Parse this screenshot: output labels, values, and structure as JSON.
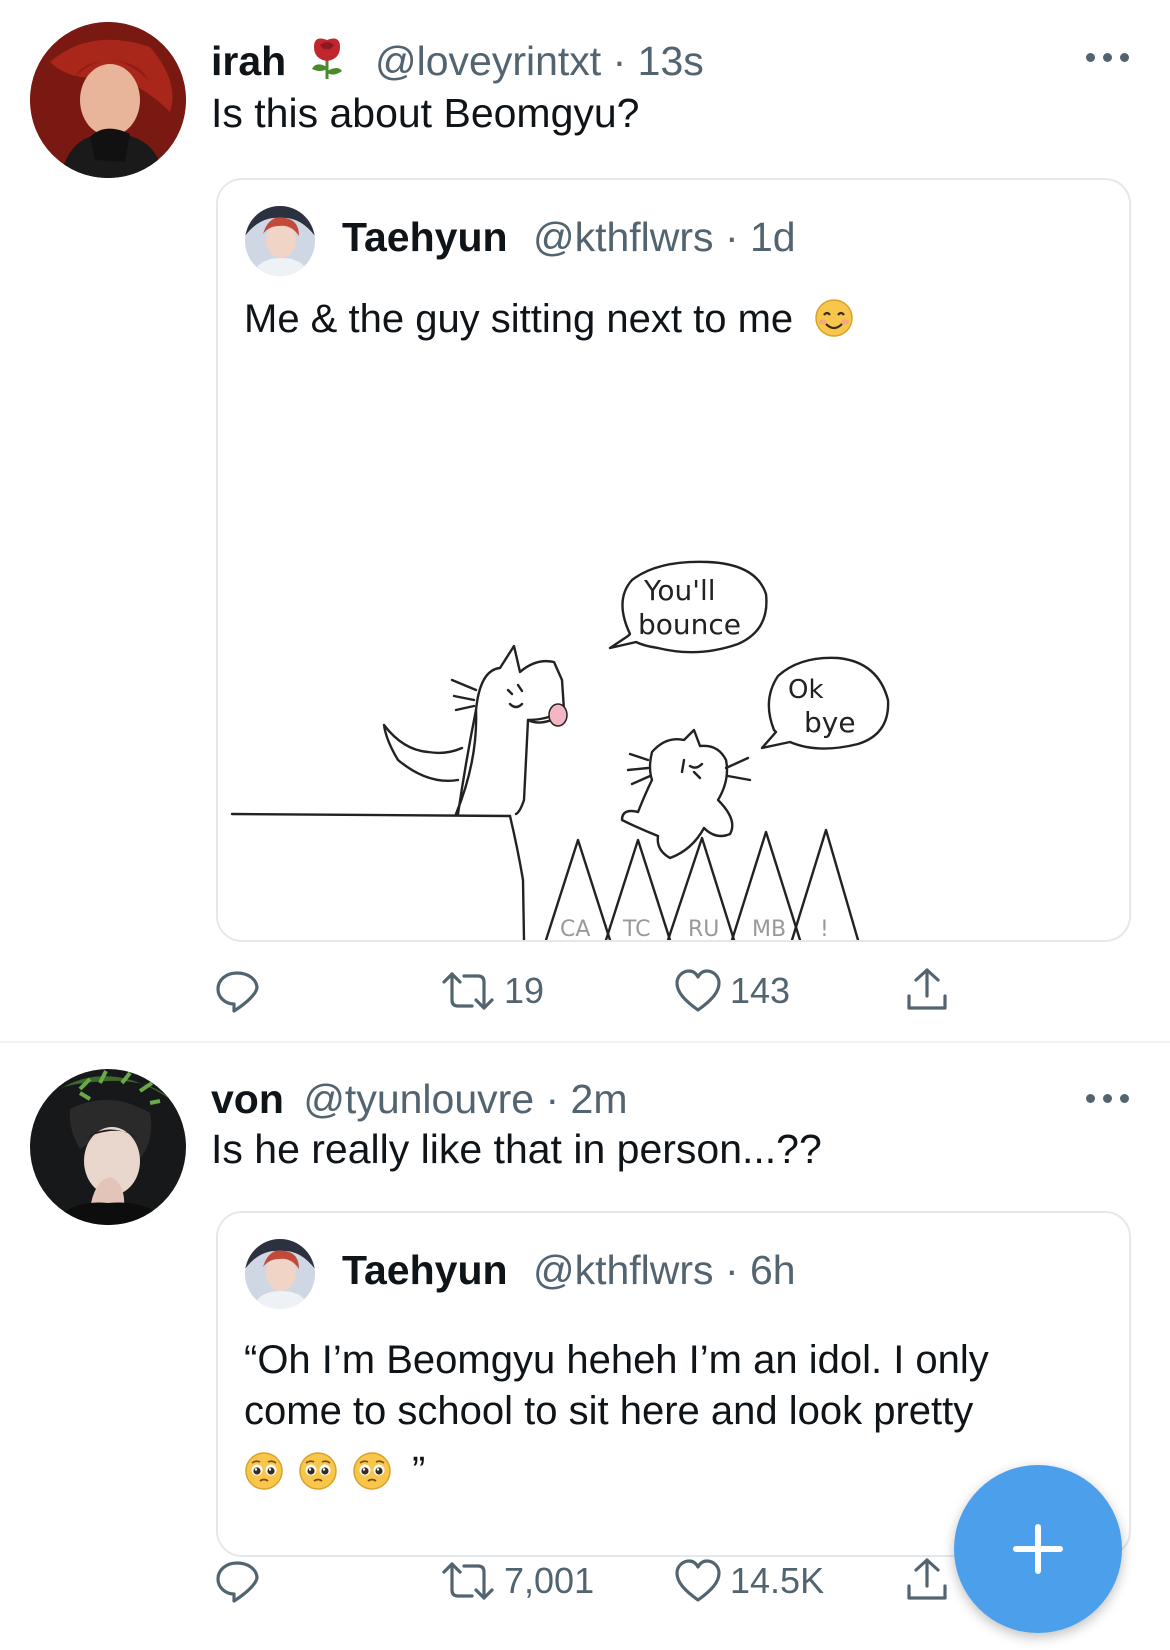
{
  "colors": {
    "accent": "#4c9fea",
    "muted": "#536471",
    "border": "#e3e8ec",
    "rose": "#c0272d"
  },
  "tweets": [
    {
      "name": "irah",
      "name_emoji": "rose-icon",
      "handle": "@loveyrintxt",
      "time": "· 13s",
      "text": "Is this about Beomgyu?",
      "quote": {
        "name": "Taehyun",
        "handle": "@kthflwrs",
        "time": "· 1d",
        "text": "Me & the guy sitting next to me",
        "text_emoji": "smiling-face-icon",
        "drawing": {
          "bubble_left": [
            "You'll",
            "bounce"
          ],
          "bubble_right": [
            "Ok",
            "bye"
          ],
          "spike_labels": [
            "CA",
            "TC",
            "RU",
            "MB",
            "!"
          ]
        }
      },
      "actions": {
        "retweets": "19",
        "likes": "143"
      }
    },
    {
      "name": "von",
      "handle": "@tyunlouvre",
      "time": "· 2m",
      "text": "Is he really like that in person...??",
      "quote": {
        "name": "Taehyun",
        "handle": "@kthflwrs",
        "time": "· 6h",
        "line1": "“Oh I’m Beomgyu heheh I’m an idol. I only",
        "line2": "come to school to sit here and look pretty",
        "closing": "”",
        "emojis": [
          "pleading-face-icon",
          "pleading-face-icon",
          "pleading-face-icon"
        ]
      },
      "actions": {
        "retweets": "7,001",
        "likes": "14.5K"
      }
    }
  ]
}
